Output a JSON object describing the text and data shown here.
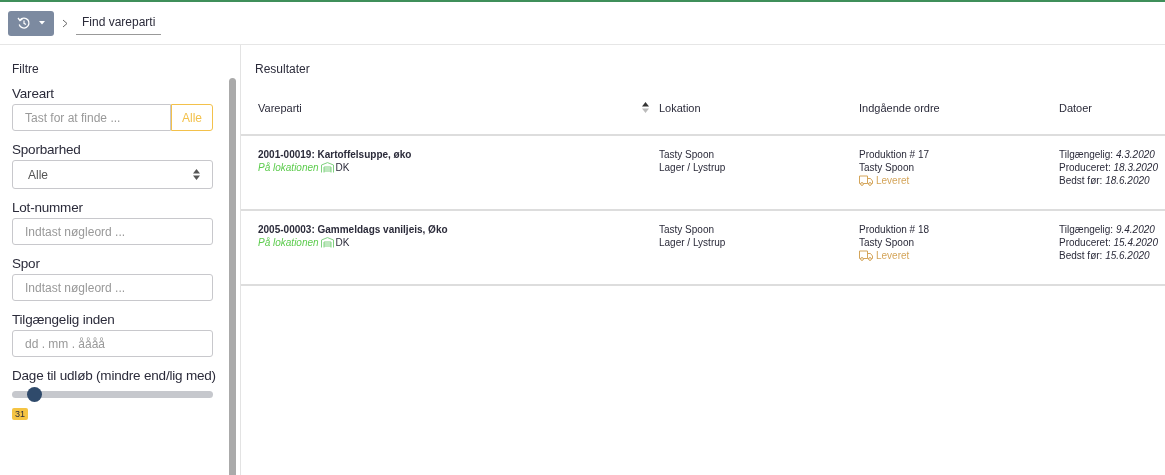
{
  "breadcrumb": {
    "current": "Find vareparti"
  },
  "filters": {
    "title": "Filtre",
    "fields": [
      {
        "kind": "search",
        "label": "Vareart",
        "placeholder": "Tast for at finde ...",
        "addon": "Alle"
      },
      {
        "kind": "select",
        "label": "Sporbarhed",
        "value": "Alle"
      },
      {
        "kind": "text",
        "label": "Lot-nummer",
        "placeholder": "Indtast nøgleord ..."
      },
      {
        "kind": "text",
        "label": "Spor",
        "placeholder": "Indtast nøgleord ..."
      },
      {
        "kind": "text",
        "label": "Tilgængelig inden",
        "placeholder": "dd . mm . åååå"
      },
      {
        "kind": "slider",
        "label": "Dage til udløb (mindre end/lig med)",
        "level": 0.11,
        "badge": "31"
      }
    ]
  },
  "results": {
    "title": "Resultater",
    "columns": [
      "Vareparti",
      "Lokation",
      "Indgående ordre",
      "Datoer"
    ],
    "rows": [
      {
        "name": "2001-00019: Kartoffelsuppe, øko",
        "status": "På lokationen",
        "country": "DK",
        "location": [
          "Tasty Spoon",
          "Lager / Lystrup"
        ],
        "order": [
          "Produktion # 17",
          "Tasty Spoon"
        ],
        "delivery": "Leveret",
        "dates": [
          "Tilgængelig: *4.3.2020*",
          "Produceret: *18.3.2020*",
          "Bedst før: *18.6.2020*"
        ]
      },
      {
        "name": "2005-00003: Gammeldags vaniljeis, Øko",
        "status": "På lokationen",
        "country": "DK",
        "location": [
          "Tasty Spoon",
          "Lager / Lystrup"
        ],
        "order": [
          "Produktion # 18",
          "Tasty Spoon"
        ],
        "delivery": "Leveret",
        "dates": [
          "Tilgængelig: *9.4.2020*",
          "Produceret: *15.4.2020*",
          "Bedst før: *15.6.2020*"
        ]
      }
    ]
  }
}
